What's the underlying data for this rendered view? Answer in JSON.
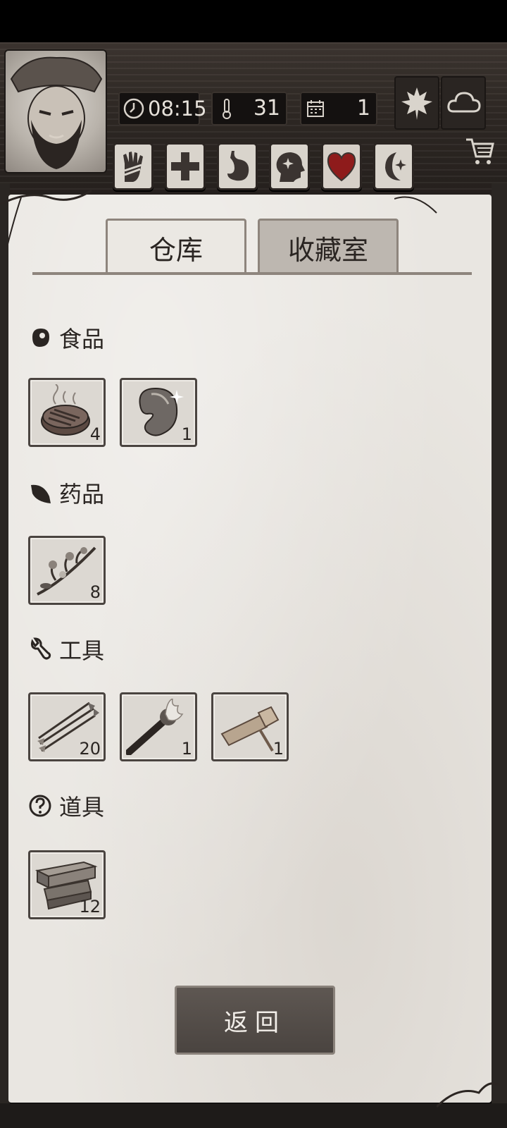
{
  "hud": {
    "time": "08:15",
    "temperature": "31",
    "day": "1",
    "status_icons": [
      "hand-bandage-icon",
      "health-cross-icon",
      "stomach-icon",
      "mind-sparkle-icon",
      "heart-icon",
      "moon-star-icon"
    ],
    "heart_color": "#8e1b1b"
  },
  "tabs": {
    "warehouse": "仓库",
    "collection": "收藏室"
  },
  "sections": [
    {
      "title": "食品",
      "icon": "meat-icon",
      "items": [
        {
          "icon": "grilled-steak-icon",
          "count": "4"
        },
        {
          "icon": "bean-icon",
          "count": "1"
        }
      ]
    },
    {
      "title": "药品",
      "icon": "leaf-icon",
      "items": [
        {
          "icon": "herb-branch-icon",
          "count": "8"
        }
      ]
    },
    {
      "title": "工具",
      "icon": "wrench-icon",
      "items": [
        {
          "icon": "arrows-icon",
          "count": "20"
        },
        {
          "icon": "torch-icon",
          "count": "1"
        },
        {
          "icon": "flashlight-icon",
          "count": "1"
        }
      ]
    },
    {
      "title": "道具",
      "icon": "question-icon",
      "items": [
        {
          "icon": "wood-planks-icon",
          "count": "12"
        }
      ]
    }
  ],
  "back_button": "返回"
}
